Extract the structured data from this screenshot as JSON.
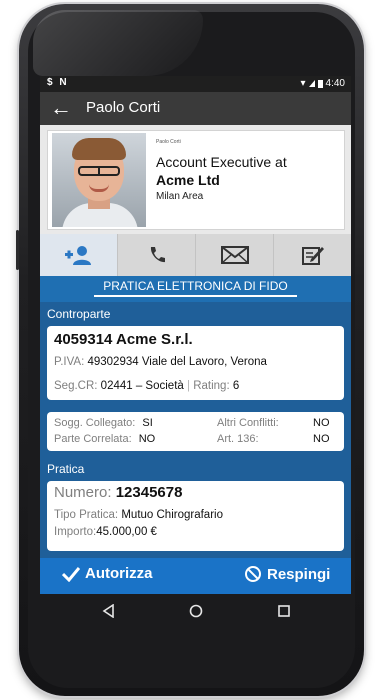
{
  "statusbar": {
    "left_icons": "$ N",
    "time": "4:40"
  },
  "appbar": {
    "title": "Paolo Corti"
  },
  "profile": {
    "small_name": "Paolo Corti",
    "role": "Account Executive at",
    "company": "Acme Ltd",
    "area": "Milan Area"
  },
  "section_tab": "PRATICA ELETTRONICA DI FIDO",
  "controparte": {
    "header": "Controparte",
    "name": "4059314 Acme S.r.l.",
    "piva_label": "P.IVA:",
    "piva_value": "49302934 Viale del Lavoro, Verona",
    "segcr_label": "Seg.CR:",
    "segcr_value": "02441 – Società",
    "rating_label": "Rating:",
    "rating_value": "6"
  },
  "flags": {
    "sogg_label": "Sogg. Collegato:",
    "sogg_value": "SI",
    "altri_label": "Altri Conflitti:",
    "altri_value": "NO",
    "parte_label": "Parte Correlata:",
    "parte_value": "NO",
    "art_label": "Art. 136:",
    "art_value": "NO"
  },
  "pratica": {
    "header": "Pratica",
    "numero_label": "Numero:",
    "numero_value": "12345678",
    "tipo_label": "Tipo Pratica:",
    "tipo_value": "Mutuo Chirografario",
    "importo_label": "Importo:",
    "importo_value": "45.000,00 €"
  },
  "actions": {
    "approve": "Autorizza",
    "reject": "Respingi"
  },
  "colors": {
    "primary": "#1f6fb2",
    "dark_blue": "#1f5f99",
    "appbar": "#3a3a3a"
  }
}
